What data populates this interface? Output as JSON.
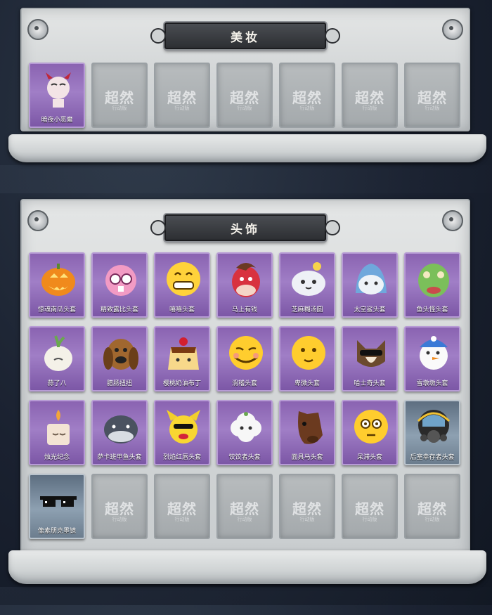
{
  "sections": {
    "makeup": {
      "title": "美妆",
      "items": [
        {
          "label": "暗夜小恶魔",
          "icon": "little-devil-icon"
        }
      ]
    },
    "headwear": {
      "title": "头饰",
      "items": [
        {
          "label": "惊魂南瓜头套",
          "icon": "pumpkin-head-icon"
        },
        {
          "label": "精致露比头套",
          "icon": "pink-beaver-icon"
        },
        {
          "label": "嘻嘻头套",
          "icon": "grin-emoji-icon"
        },
        {
          "label": "马上有钱",
          "icon": "red-horse-icon"
        },
        {
          "label": "芝麻糊汤圆",
          "icon": "dumpling-icon"
        },
        {
          "label": "太空鲨头套",
          "icon": "space-shark-icon"
        },
        {
          "label": "鱼头怪头套",
          "icon": "fish-head-icon"
        },
        {
          "label": "蒜了八",
          "icon": "garlic-icon"
        },
        {
          "label": "腊肠扭扭",
          "icon": "dachshund-icon"
        },
        {
          "label": "樱桃奶油布丁",
          "icon": "pudding-icon"
        },
        {
          "label": "滑稽头套",
          "icon": "funny-emoji-icon"
        },
        {
          "label": "卑微头套",
          "icon": "humble-emoji-icon"
        },
        {
          "label": "哈士奇头套",
          "icon": "husky-icon"
        },
        {
          "label": "雪墩墩头套",
          "icon": "snowman-icon"
        },
        {
          "label": "烛光纪念",
          "icon": "candle-icon"
        },
        {
          "label": "萨卡班甲鱼头套",
          "icon": "sacabambaspis-icon"
        },
        {
          "label": "烈焰红唇头套",
          "icon": "red-lips-icon"
        },
        {
          "label": "饺饺者头套",
          "icon": "cloud-dumpling-icon"
        },
        {
          "label": "面具马头套",
          "icon": "horse-mask-icon"
        },
        {
          "label": "呆滞头套",
          "icon": "dazed-emoji-icon"
        },
        {
          "label": "后室幸存者头套",
          "icon": "gas-mask-icon"
        },
        {
          "label": "像素朋克墨镜",
          "icon": "pixel-sunglasses-icon"
        }
      ]
    },
    "placeholder": {
      "watermark": "超然",
      "sub": "行动版"
    }
  }
}
